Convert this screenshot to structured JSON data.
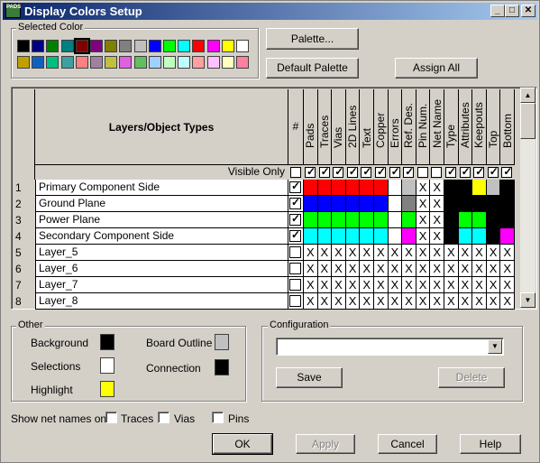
{
  "window": {
    "title": "Display Colors Setup",
    "app_icon": "PADS"
  },
  "selected_color": {
    "label": "Selected Color",
    "palette": [
      [
        "#000000",
        "#000080",
        "#008000",
        "#008080",
        "#800000",
        "#800080",
        "#808000",
        "#808080",
        "#c0c0c0",
        "#0000ff",
        "#00ff00",
        "#00ffff",
        "#ff0000",
        "#ff00ff",
        "#ffff00",
        "#ffffff"
      ],
      [
        "#c0a000",
        "#1060c0",
        "#00c080",
        "#40a0a0",
        "#ff8080",
        "#a080a0",
        "#c0c040",
        "#e060e0",
        "#60c060",
        "#a0d0ff",
        "#c0ffc0",
        "#c0ffff",
        "#ffa0a0",
        "#ffc0ff",
        "#ffffc0",
        "#ff80a0"
      ]
    ]
  },
  "buttons": {
    "palette": "Palette...",
    "default_palette": "Default Palette",
    "assign_all": "Assign All",
    "save": "Save",
    "delete": "Delete",
    "ok": "OK",
    "apply": "Apply",
    "cancel": "Cancel",
    "help": "Help"
  },
  "grid": {
    "header_title": "Layers/Object Types",
    "num_col": "#",
    "columns": [
      "Pads",
      "Traces",
      "Vias",
      "2D Lines",
      "Text",
      "Copper",
      "Errors",
      "Ref. Des.",
      "Pin Num.",
      "Net Name",
      "Type",
      "Attributes",
      "Keepouts",
      "Top",
      "Bottom"
    ],
    "visible_only": "Visible Only",
    "rows": [
      {
        "num": "1",
        "name": "Primary Component Side",
        "checked": true,
        "cells": [
          "#ff0000",
          "#ff0000",
          "#ff0000",
          "#ff0000",
          "#ff0000",
          "#ff0000",
          "#ffffff",
          "#c0c0c0",
          "X",
          "X",
          "#000000",
          "#000000",
          "#ffff00",
          "#c0c0c0",
          "#000000"
        ]
      },
      {
        "num": "2",
        "name": "Ground Plane",
        "checked": true,
        "cells": [
          "#0000ff",
          "#0000ff",
          "#0000ff",
          "#0000ff",
          "#0000ff",
          "#0000ff",
          "#ffffff",
          "#808080",
          "X",
          "X",
          "#000000",
          "#000000",
          "#000000",
          "#000000",
          "#000000"
        ]
      },
      {
        "num": "3",
        "name": "Power Plane",
        "checked": true,
        "cells": [
          "#00ff00",
          "#00ff00",
          "#00ff00",
          "#00ff00",
          "#00ff00",
          "#00ff00",
          "#ffffff",
          "#00ff00",
          "X",
          "X",
          "#000000",
          "#00ff00",
          "#00ff00",
          "#000000",
          "#000000"
        ]
      },
      {
        "num": "4",
        "name": "Secondary Component Side",
        "checked": true,
        "cells": [
          "#00ffff",
          "#00ffff",
          "#00ffff",
          "#00ffff",
          "#00ffff",
          "#00ffff",
          "#ffffff",
          "#ff00ff",
          "X",
          "X",
          "#000000",
          "#00ffff",
          "#00ffff",
          "#000000",
          "#ff00ff"
        ]
      },
      {
        "num": "5",
        "name": "Layer_5",
        "checked": false,
        "cells": [
          "X",
          "X",
          "X",
          "X",
          "X",
          "X",
          "X",
          "X",
          "X",
          "X",
          "X",
          "X",
          "X",
          "X",
          "X"
        ]
      },
      {
        "num": "6",
        "name": "Layer_6",
        "checked": false,
        "cells": [
          "X",
          "X",
          "X",
          "X",
          "X",
          "X",
          "X",
          "X",
          "X",
          "X",
          "X",
          "X",
          "X",
          "X",
          "X"
        ]
      },
      {
        "num": "7",
        "name": "Layer_7",
        "checked": false,
        "cells": [
          "X",
          "X",
          "X",
          "X",
          "X",
          "X",
          "X",
          "X",
          "X",
          "X",
          "X",
          "X",
          "X",
          "X",
          "X"
        ]
      },
      {
        "num": "8",
        "name": "Layer_8",
        "checked": false,
        "cells": [
          "X",
          "X",
          "X",
          "X",
          "X",
          "X",
          "X",
          "X",
          "X",
          "X",
          "X",
          "X",
          "X",
          "X",
          "X"
        ]
      }
    ],
    "visible_only_checks": [
      false,
      true,
      true,
      true,
      true,
      true,
      true,
      true,
      true,
      false,
      false,
      true,
      true,
      true,
      true,
      true
    ]
  },
  "other": {
    "label": "Other",
    "background": "Background",
    "background_color": "#000000",
    "selections": "Selections",
    "selections_color": "#ffffff",
    "highlight": "Highlight",
    "highlight_color": "#ffff00",
    "board_outline": "Board Outline",
    "board_outline_color": "#c0c0c0",
    "connection": "Connection",
    "connection_color": "#000000"
  },
  "configuration": {
    "label": "Configuration",
    "value": ""
  },
  "net_names": {
    "label": "Show net names on",
    "traces": "Traces",
    "vias": "Vias",
    "pins": "Pins"
  }
}
